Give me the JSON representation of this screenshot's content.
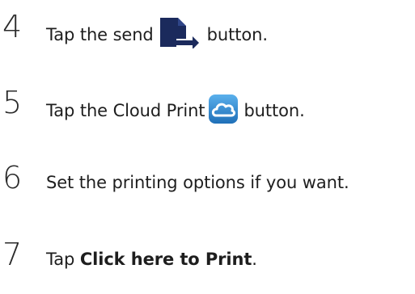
{
  "steps": [
    {
      "number": "4",
      "before": "Tap the send",
      "after": "button.",
      "icon": "send-icon"
    },
    {
      "number": "5",
      "before": "Tap the Cloud Print",
      "after": "button.",
      "icon": "cloud-print-icon"
    },
    {
      "number": "6",
      "text": "Set the printing options if you want."
    },
    {
      "number": "7",
      "before": "Tap ",
      "bold": "Click here to Print",
      "after": "."
    }
  ],
  "colors": {
    "text": "#1e1e1e",
    "send_icon": "#1b2a5c",
    "cloud_icon_bg": "#2a7fc6",
    "cloud_icon_stroke": "#ffffff"
  }
}
